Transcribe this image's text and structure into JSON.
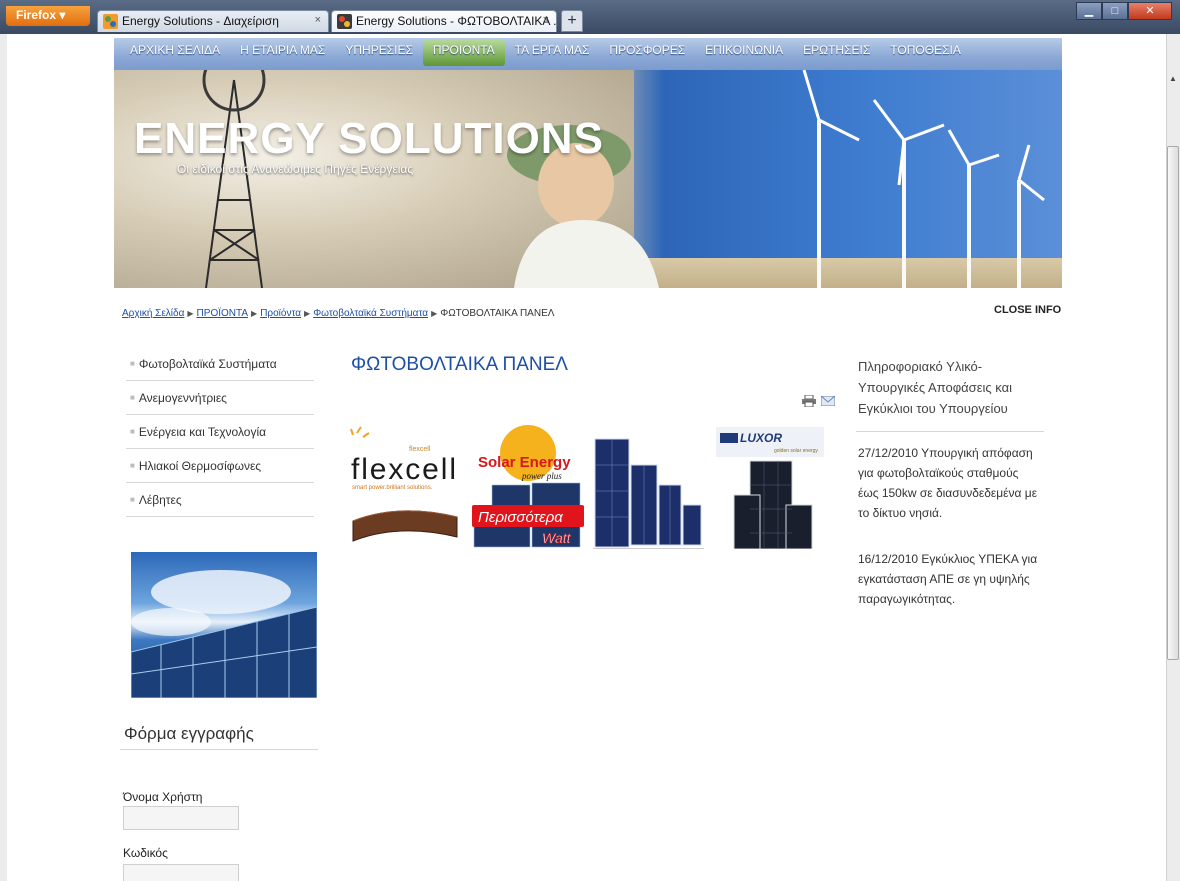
{
  "browser": {
    "menu_label": "Firefox",
    "tabs": [
      {
        "title": "Energy Solutions - Διαχείριση"
      },
      {
        "title": "Energy Solutions - ΦΩΤΟΒΟΛΤΑΙΚΑ ..."
      }
    ],
    "new_tab": "+",
    "tab_close": "×"
  },
  "nav": {
    "items": [
      {
        "label": "ΑΡΧΙΚΗ ΣΕΛΙΔΑ"
      },
      {
        "label": "Η ΕΤΑΙΡΙΑ ΜΑΣ"
      },
      {
        "label": "ΥΠΗΡΕΣΙΕΣ"
      },
      {
        "label": "ΠΡΟΙΟΝΤΑ"
      },
      {
        "label": "ΤΑ ΕΡΓΑ ΜΑΣ"
      },
      {
        "label": "ΠΡΟΣΦΟΡΕΣ"
      },
      {
        "label": "ΕΠΙΚΟΙΝΩΝΙΑ"
      },
      {
        "label": "ΕΡΩΤΗΣΕΙΣ"
      },
      {
        "label": "ΤΟΠΟΘΕΣΙΑ"
      }
    ],
    "active_index": 3
  },
  "banner": {
    "title": "ENERGY SOLUTIONS",
    "subtitle": "Οι ειδικοί στις Ανανεώσιμες Πηγές Ενέργειας"
  },
  "breadcrumb": {
    "links": [
      "Αρχική Σελίδα",
      "ΠΡΟΪΟΝΤΑ",
      "Προϊόντα",
      "Φωτοβολταϊκά Συστήματα"
    ],
    "current": "ΦΩΤΟΒΟΛΤΑΙΚΑ ΠΑΝΕΛ",
    "close_info": "CLOSE INFO"
  },
  "sidebar": {
    "items": [
      {
        "label": "Φωτοβολταϊκά Συστήματα"
      },
      {
        "label": "Ανεμογεννήτριες"
      },
      {
        "label": "Ενέργεια και Τεχνολογία"
      },
      {
        "label": "Ηλιακοί Θερμοσίφωνες"
      },
      {
        "label": "Λέβητες"
      }
    ],
    "bullet": "■"
  },
  "registration": {
    "title": "Φόρμα εγγραφής",
    "username_label": "Όνομα Χρήστη",
    "password_label": "Κωδικός",
    "username_value": "",
    "password_value": ""
  },
  "main": {
    "title": "ΦΩΤΟΒΟΛΤΑΙΚΑ ΠΑΝΕΛ",
    "products": [
      {
        "brand": "flexcell",
        "brand_small": "flexcell",
        "tagline": "smart power.brilliant solutions."
      },
      {
        "brand": "Solar Energy",
        "sub": "power plus",
        "promo_line1": "Περισσότερα",
        "promo_line2": "Watt"
      },
      {
        "brand": ""
      },
      {
        "brand": "LUXOR",
        "sub": "golden solar energy"
      }
    ]
  },
  "right": {
    "title": "Πληροφοριακό Υλικό-Υπουργικές Αποφάσεις και Εγκύκλιοι του Υπουργείου",
    "news": [
      {
        "text": "27/12/2010 Υπουργική απόφαση για φωτοβολταϊκούς σταθμούς έως 150kw σε διασυνδεδεμένα με το δίκτυο νησιά."
      },
      {
        "text": "16/12/2010  Εγκύκλιος ΥΠΕΚΑ για εγκατάσταση ΑΠΕ σε γη υψηλής παραγωγικότητας."
      }
    ]
  },
  "colors": {
    "link": "#1d4fa8",
    "nav_active": "#5f9637",
    "nav_bg": "#8ba8d6"
  }
}
